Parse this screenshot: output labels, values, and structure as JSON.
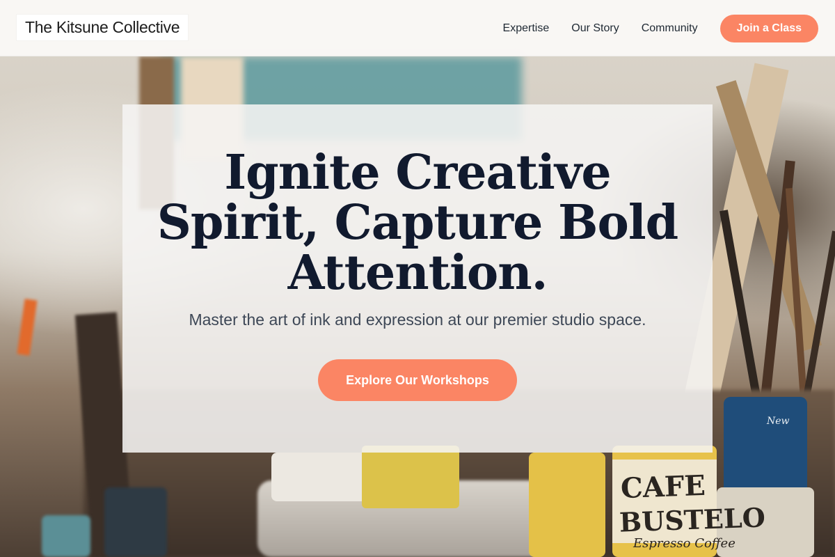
{
  "header": {
    "logo_text": "The Kitsune Collective",
    "nav": [
      {
        "label": "Expertise"
      },
      {
        "label": "Our Story"
      },
      {
        "label": "Community"
      }
    ],
    "cta_label": "Join a Class"
  },
  "hero": {
    "title": "Ignite Creative Spirit, Capture Bold Attention.",
    "subtitle": "Master the art of ink and expression at our premier studio space.",
    "cta_label": "Explore Our Workshops"
  },
  "background_photo": {
    "can_label_line1": "CAFE",
    "can_label_line2": "BUSTELO",
    "can_label_line3": "Espresso Coffee",
    "paint_can_label": "New"
  },
  "colors": {
    "accent": "#fb8564",
    "title_text": "#111a2e",
    "body_text": "#3d4756",
    "header_bg": "#faf8f6"
  }
}
